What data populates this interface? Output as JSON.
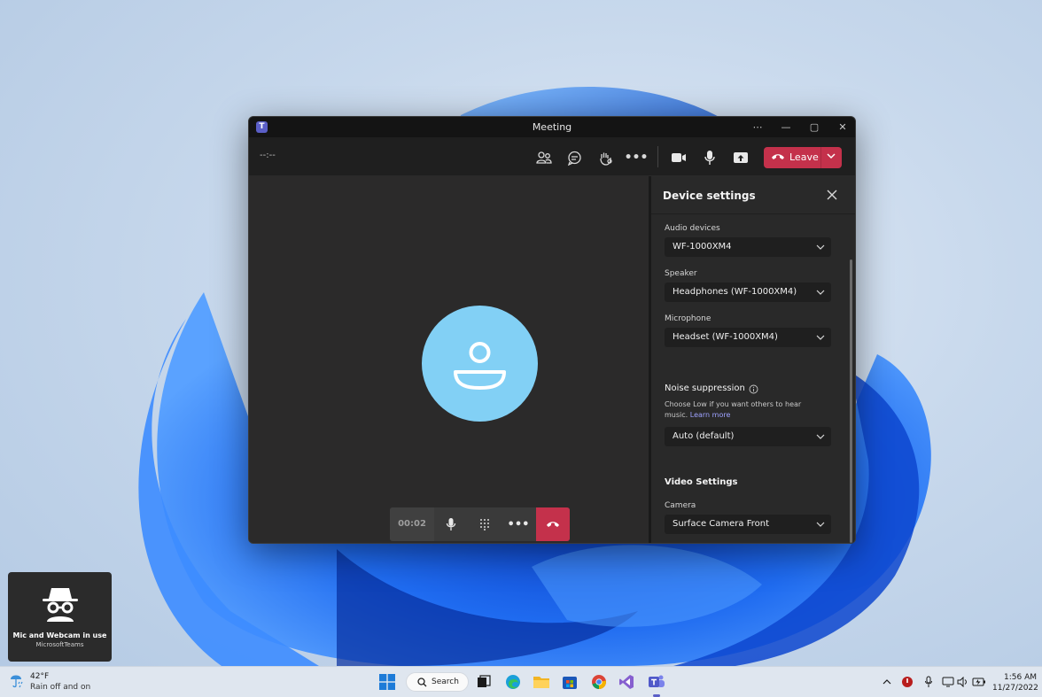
{
  "window": {
    "title": "Meeting",
    "timer_top": "--:--",
    "leave_label": "Leave"
  },
  "call": {
    "elapsed": "00:02"
  },
  "device_settings": {
    "title": "Device settings",
    "audio_devices_label": "Audio devices",
    "audio_devices_value": "WF-1000XM4",
    "speaker_label": "Speaker",
    "speaker_value": "Headphones (WF-1000XM4)",
    "microphone_label": "Microphone",
    "microphone_value": "Headset (WF-1000XM4)",
    "noise_title": "Noise suppression",
    "noise_hint": "Choose Low if you want others to hear music.",
    "noise_link": "Learn more",
    "noise_value": "Auto (default)",
    "video_title": "Video Settings",
    "camera_label": "Camera",
    "camera_value": "Surface Camera Front"
  },
  "notification": {
    "title": "Mic and Webcam in use",
    "app": "MicrosoftTeams"
  },
  "taskbar": {
    "weather_temp": "42°F",
    "weather_cond": "Rain off and on",
    "search_label": "Search",
    "time": "1:56 AM",
    "date": "11/27/2022"
  },
  "colors": {
    "leave_red": "#c4314b",
    "avatar_blue": "#82d0f5",
    "teams_purple": "#5b5fc7",
    "link": "#9ea2ff"
  }
}
